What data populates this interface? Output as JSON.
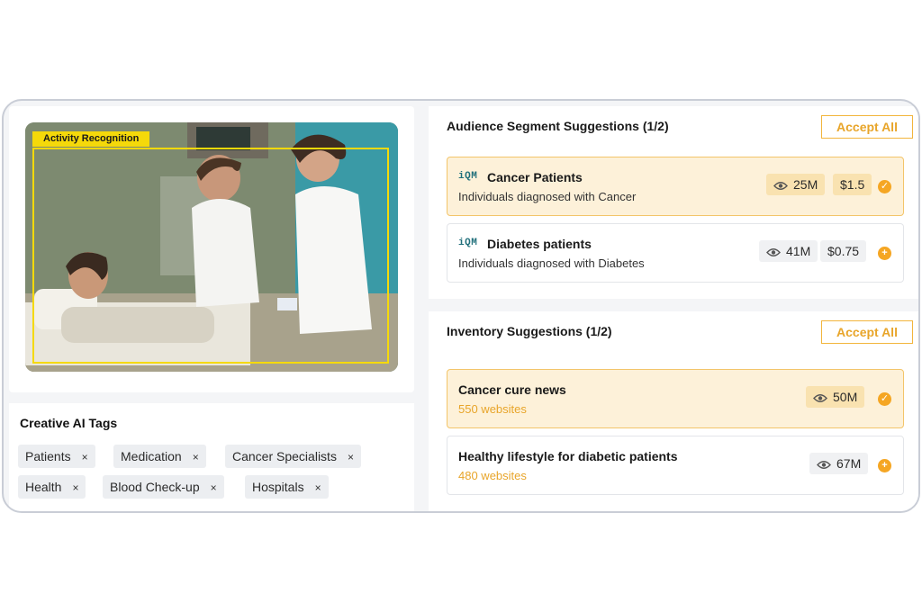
{
  "image_card": {
    "detection_label": "Activity Recognition"
  },
  "creative_tags": {
    "title": "Creative AI Tags",
    "remove_glyph": "×",
    "tags": [
      "Patients",
      "Medication",
      "Cancer Specialists",
      "Health",
      "Blood Check-up",
      "Hospitals"
    ]
  },
  "audience": {
    "title": "Audience Segment Suggestions (1/2)",
    "accept_all_label": "Accept All",
    "items": [
      {
        "logo": "iQM",
        "name": "Cancer Patients",
        "description": "Individuals diagnosed with Cancer",
        "reach": "25M",
        "price": "$1.5",
        "status": "accepted",
        "status_icon": "check-icon"
      },
      {
        "logo": "iQM",
        "name": "Diabetes patients",
        "description": "Individuals diagnosed with Diabetes",
        "reach": "41M",
        "price": "$0.75",
        "status": "suggested",
        "status_icon": "plus-icon"
      }
    ]
  },
  "inventory": {
    "title": "Inventory Suggestions (1/2)",
    "accept_all_label": "Accept All",
    "items": [
      {
        "name": "Cancer cure news",
        "websites": "550 websites",
        "reach": "50M",
        "status": "accepted",
        "status_icon": "check-icon"
      },
      {
        "name": "Healthy lifestyle for diabetic patients",
        "websites": "480 websites",
        "reach": "67M",
        "status": "suggested",
        "status_icon": "plus-icon"
      }
    ]
  },
  "colors": {
    "accent": "#f5a623",
    "accept_border": "#f2b53c",
    "selected_bg": "#fdf1d9",
    "detection_yellow": "#f5d90a"
  }
}
